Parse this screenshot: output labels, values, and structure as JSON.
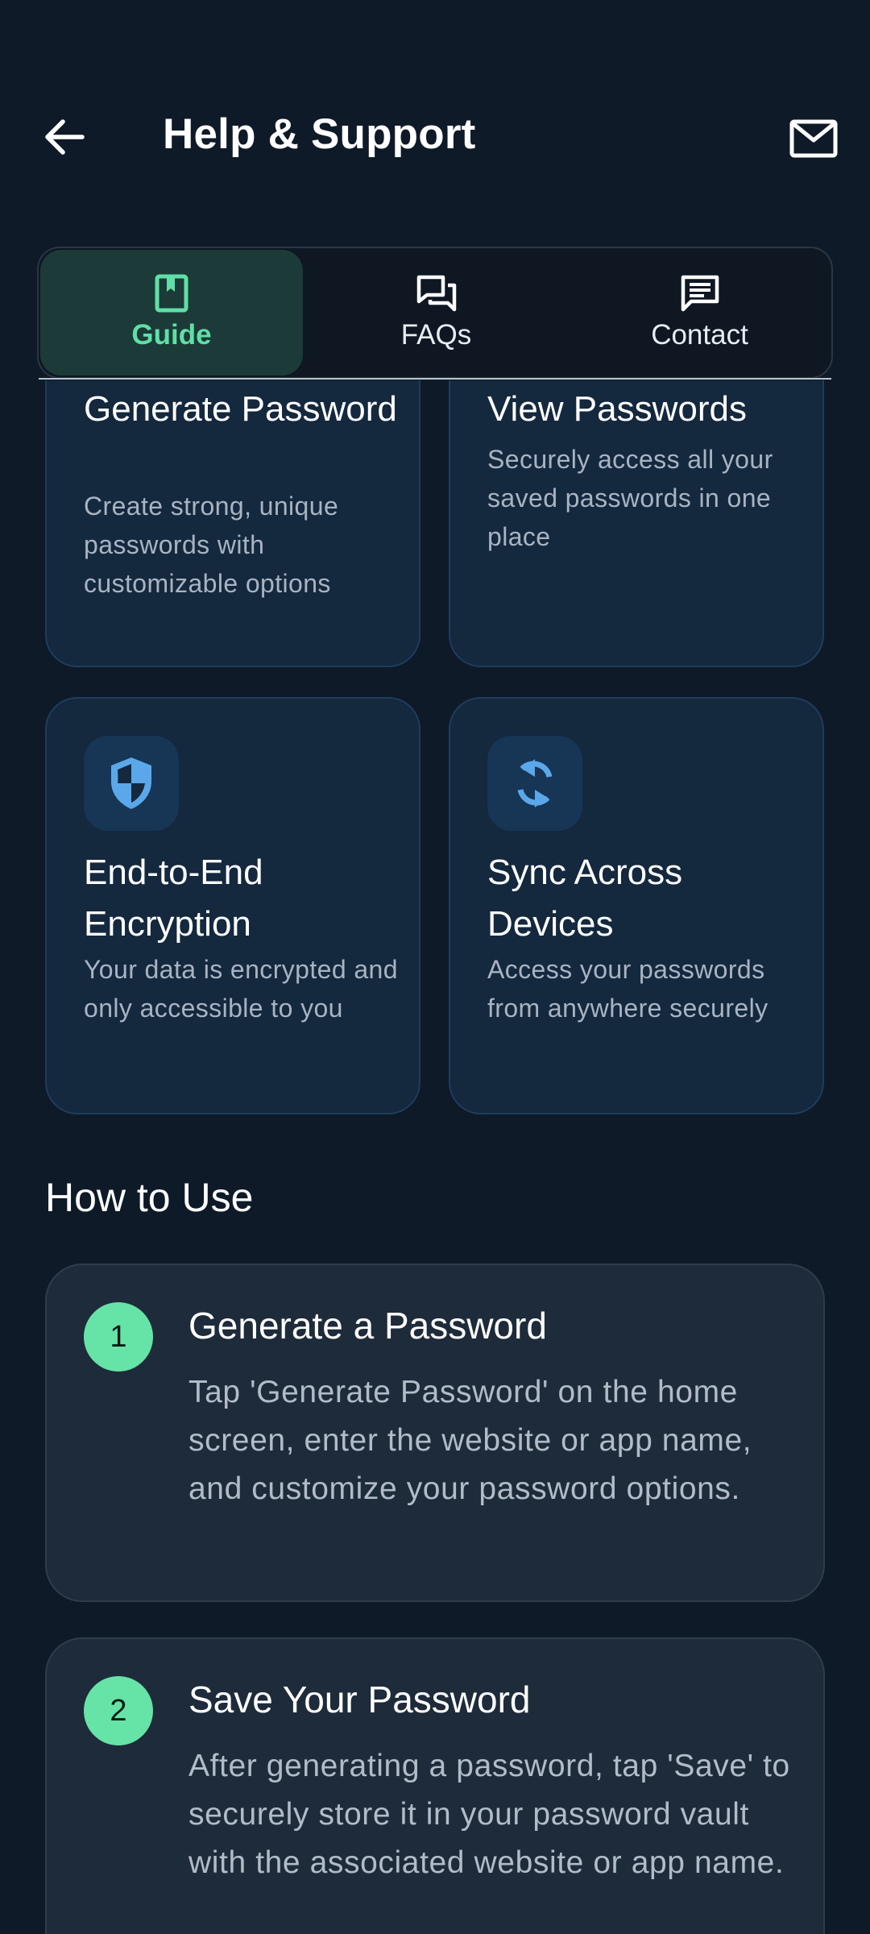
{
  "header": {
    "title": "Help & Support",
    "back_icon": "arrow-left-icon",
    "mail_icon": "mail-icon"
  },
  "tabs": [
    {
      "label": "Guide",
      "icon": "book-icon",
      "active": true
    },
    {
      "label": "FAQs",
      "icon": "chat-bubbles-icon",
      "active": false
    },
    {
      "label": "Contact",
      "icon": "message-icon",
      "active": false
    }
  ],
  "features": [
    {
      "title": "Generate Password",
      "description": "Create strong, unique passwords with customizable options"
    },
    {
      "title": "View Passwords",
      "description": "Securely access all your saved passwords in one place"
    },
    {
      "title": "End-to-End Encryption",
      "description": "Your data is encrypted and only accessible to you",
      "icon": "shield-icon"
    },
    {
      "title": "Sync Across Devices",
      "description": "Access your passwords from anywhere securely",
      "icon": "sync-icon"
    }
  ],
  "how_to_use": {
    "title": "How to Use",
    "steps": [
      {
        "number": "1",
        "title": "Generate a Password",
        "description": "Tap 'Generate Password' on the home screen, enter the website or app name, and customize your password options."
      },
      {
        "number": "2",
        "title": "Save Your Password",
        "description": "After generating a password, tap 'Save' to securely store it in your password vault with the associated website or app name."
      }
    ]
  },
  "colors": {
    "background": "#0f1a28",
    "accent_green": "#5fe0a6",
    "icon_blue": "#5aa8ea",
    "card_background": "#14283e",
    "step_background": "#1e2b3a"
  }
}
